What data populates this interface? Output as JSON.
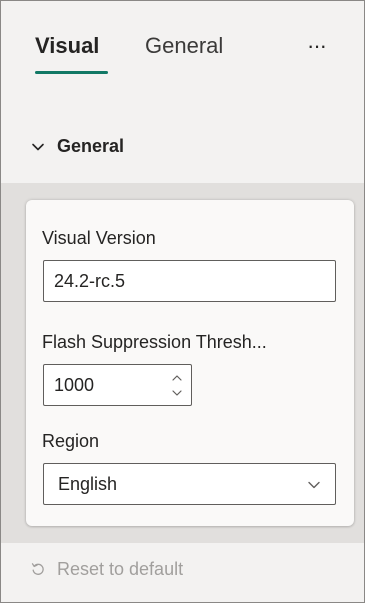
{
  "tabs": [
    {
      "label": "Visual",
      "active": true
    },
    {
      "label": "General",
      "active": false
    }
  ],
  "more_icon": "more-horizontal-icon",
  "section": {
    "title": "General",
    "expanded": true,
    "icon": "chevron-down-icon"
  },
  "fields": {
    "visual_version": {
      "label": "Visual Version",
      "value": "24.2-rc.5"
    },
    "flash_suppression": {
      "label": "Flash Suppression Thresh...",
      "value": "1000"
    },
    "region": {
      "label": "Region",
      "selected": "English"
    }
  },
  "reset": {
    "label": "Reset to default",
    "icon": "reset-icon",
    "disabled": true
  },
  "colors": {
    "accent": "#117865",
    "panel_bg": "#f3f2f1",
    "band_bg": "#e1dfdd",
    "card_bg": "#faf9f8",
    "disabled_text": "#a19f9d"
  }
}
